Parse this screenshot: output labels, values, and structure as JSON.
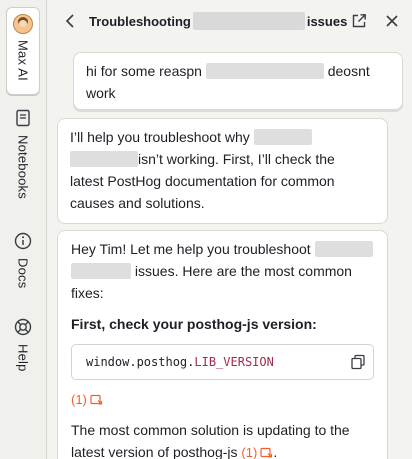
{
  "rail": {
    "items": [
      {
        "label": "Max AI",
        "active": true,
        "icon": "avatar-icon"
      },
      {
        "label": "Notebooks",
        "active": false,
        "icon": "notebook-icon"
      },
      {
        "label": "Docs",
        "active": false,
        "icon": "info-icon"
      },
      {
        "label": "Help",
        "active": false,
        "icon": "lifebuoy-icon"
      }
    ]
  },
  "header": {
    "title_start": "Troubleshooting",
    "title_end": "issues"
  },
  "messages": {
    "user": {
      "part1": "hi for some reaspn",
      "part2": "deosnt",
      "line2": "work"
    },
    "ai1": {
      "line1": "I’ll help you troubleshoot why",
      "line2": "isn’t working. First, I’ll check the",
      "line3": "latest PostHog documentation for common",
      "line4": "causes and solutions."
    },
    "ai2": {
      "line1": "Hey Tim! Let me help you troubleshoot",
      "line2": "issues. Here are the most common",
      "line3": "fixes:",
      "heading": "First, check your posthog-js version:",
      "code_obj": "window.posthog.",
      "code_prop": "LIB_VERSION",
      "cite1": "(1)",
      "body1": "The most common solution is updating to the",
      "body2": "latest version of posthog-js",
      "cite2": "(1)",
      "body2_end": "."
    }
  },
  "colors": {
    "accent": "#f35e2c",
    "code_prop": "#a32c4a"
  }
}
